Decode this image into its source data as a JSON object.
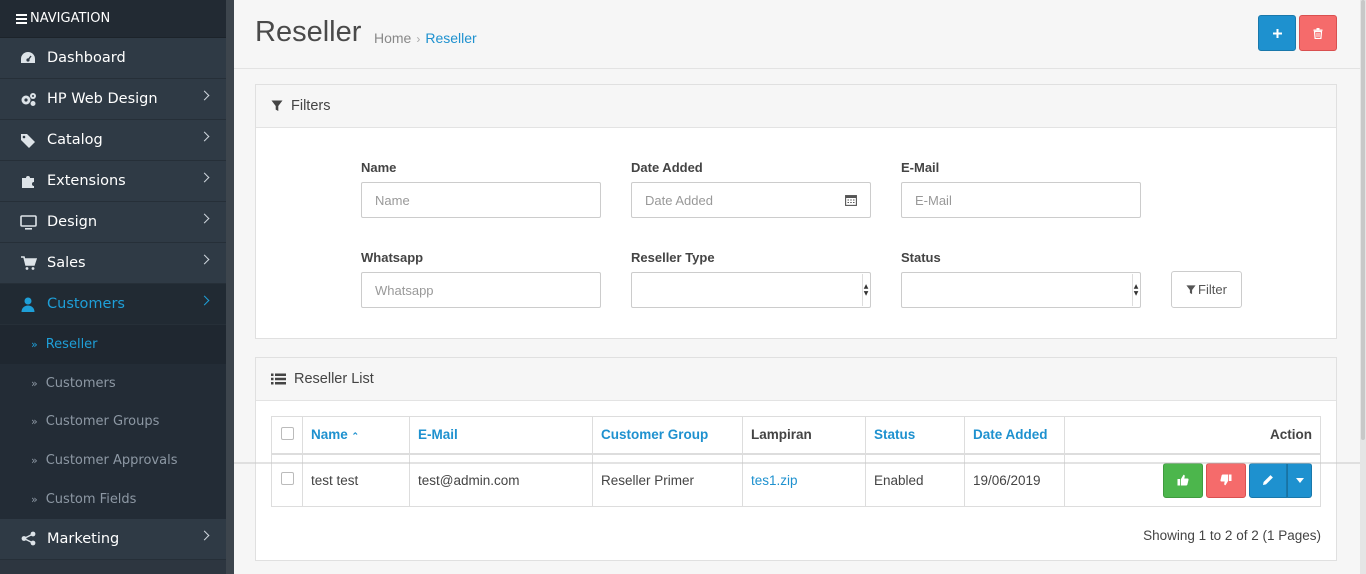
{
  "sidebar": {
    "header": "NAVIGATION",
    "items": [
      {
        "label": "Dashboard",
        "icon": "dashboard-icon",
        "has_children": false
      },
      {
        "label": "HP Web Design",
        "icon": "cogs-icon",
        "has_children": true
      },
      {
        "label": "Catalog",
        "icon": "tags-icon",
        "has_children": true
      },
      {
        "label": "Extensions",
        "icon": "puzzle-icon",
        "has_children": true
      },
      {
        "label": "Design",
        "icon": "monitor-icon",
        "has_children": true
      },
      {
        "label": "Sales",
        "icon": "cart-icon",
        "has_children": true
      },
      {
        "label": "Customers",
        "icon": "user-icon",
        "has_children": true,
        "active": true
      }
    ],
    "submenu": [
      "Reseller",
      "Customers",
      "Customer Groups",
      "Customer Approvals",
      "Custom Fields"
    ],
    "after": {
      "label": "Marketing",
      "icon": "share-icon"
    }
  },
  "header": {
    "title": "Reseller",
    "breadcrumb": [
      "Home",
      "Reseller"
    ]
  },
  "filters": {
    "heading": "Filters",
    "name_label": "Name",
    "name_placeholder": "Name",
    "date_label": "Date Added",
    "date_placeholder": "Date Added",
    "email_label": "E-Mail",
    "email_placeholder": "E-Mail",
    "whatsapp_label": "Whatsapp",
    "whatsapp_placeholder": "Whatsapp",
    "type_label": "Reseller Type",
    "status_label": "Status",
    "filter_button": "Filter"
  },
  "list": {
    "heading": "Reseller List",
    "columns": [
      "Name",
      "E-Mail",
      "Customer Group",
      "Lampiran",
      "Status",
      "Date Added",
      "Action"
    ],
    "rows": [
      {
        "name": "test test",
        "email": "test@admin.com",
        "group": "Reseller Primer",
        "lampiran": "tes1.zip",
        "status": "Enabled",
        "date": "19/06/2019"
      }
    ],
    "pagination": "Showing 1 to 2 of 2 (1 Pages)"
  },
  "colors": {
    "accent": "#1e91cf",
    "danger": "#f56b6b",
    "success": "#4cb64c",
    "sidebar": "#2d3640"
  }
}
